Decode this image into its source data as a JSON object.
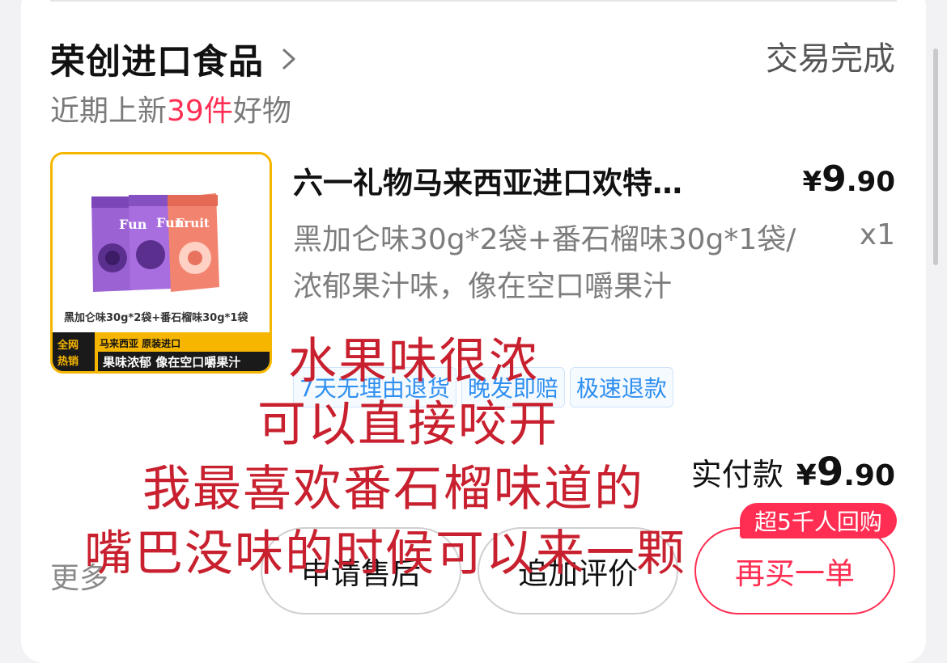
{
  "shop": {
    "name": "荣创进口食品",
    "status": "交易完成",
    "subtitle_prefix": "近期上新",
    "subtitle_count": "39件",
    "subtitle_suffix": "好物"
  },
  "product": {
    "title": "六一礼物马来西亚进口欢特…",
    "price_currency": "¥",
    "price_int": "9",
    "price_dec": ".90",
    "spec": "黑加仑味30g*2袋+番石榴味30g*1袋/浓郁果汁味，像在空口嚼果汁",
    "quantity": "x1",
    "image": {
      "caption": "黑加仑味30g*2袋+番石榴味30g*1袋",
      "corner_badge_line1": "全网",
      "corner_badge_line2": "热销",
      "origin_label": "马来西亚  原装进口",
      "slogan": "果味浓郁 像在空口嚼果汁",
      "colors": {
        "border": "#f6b600",
        "bag_purple": "#8a55c8",
        "bag_pink": "#f2846f"
      }
    },
    "tags": [
      "7天无理由退货",
      "晚发即赔",
      "极速退款"
    ]
  },
  "payment": {
    "label": "实付款",
    "currency": "¥",
    "amount_int": "9",
    "amount_dec": ".90"
  },
  "actions": {
    "more": "更多",
    "after_sale": "申请售后",
    "review": "追加评价",
    "rebuy": "再买一单",
    "rebuy_badge": "超5千人回购"
  },
  "overlay_text": [
    "水果味很浓",
    "可以直接咬开",
    "我最喜欢番石榴味道的",
    "嘴巴没味的时候可以来一颗"
  ],
  "colors": {
    "accent": "#ff2e52",
    "tag_blue": "#2f8ff0",
    "overlay_red": "#c8202e"
  }
}
